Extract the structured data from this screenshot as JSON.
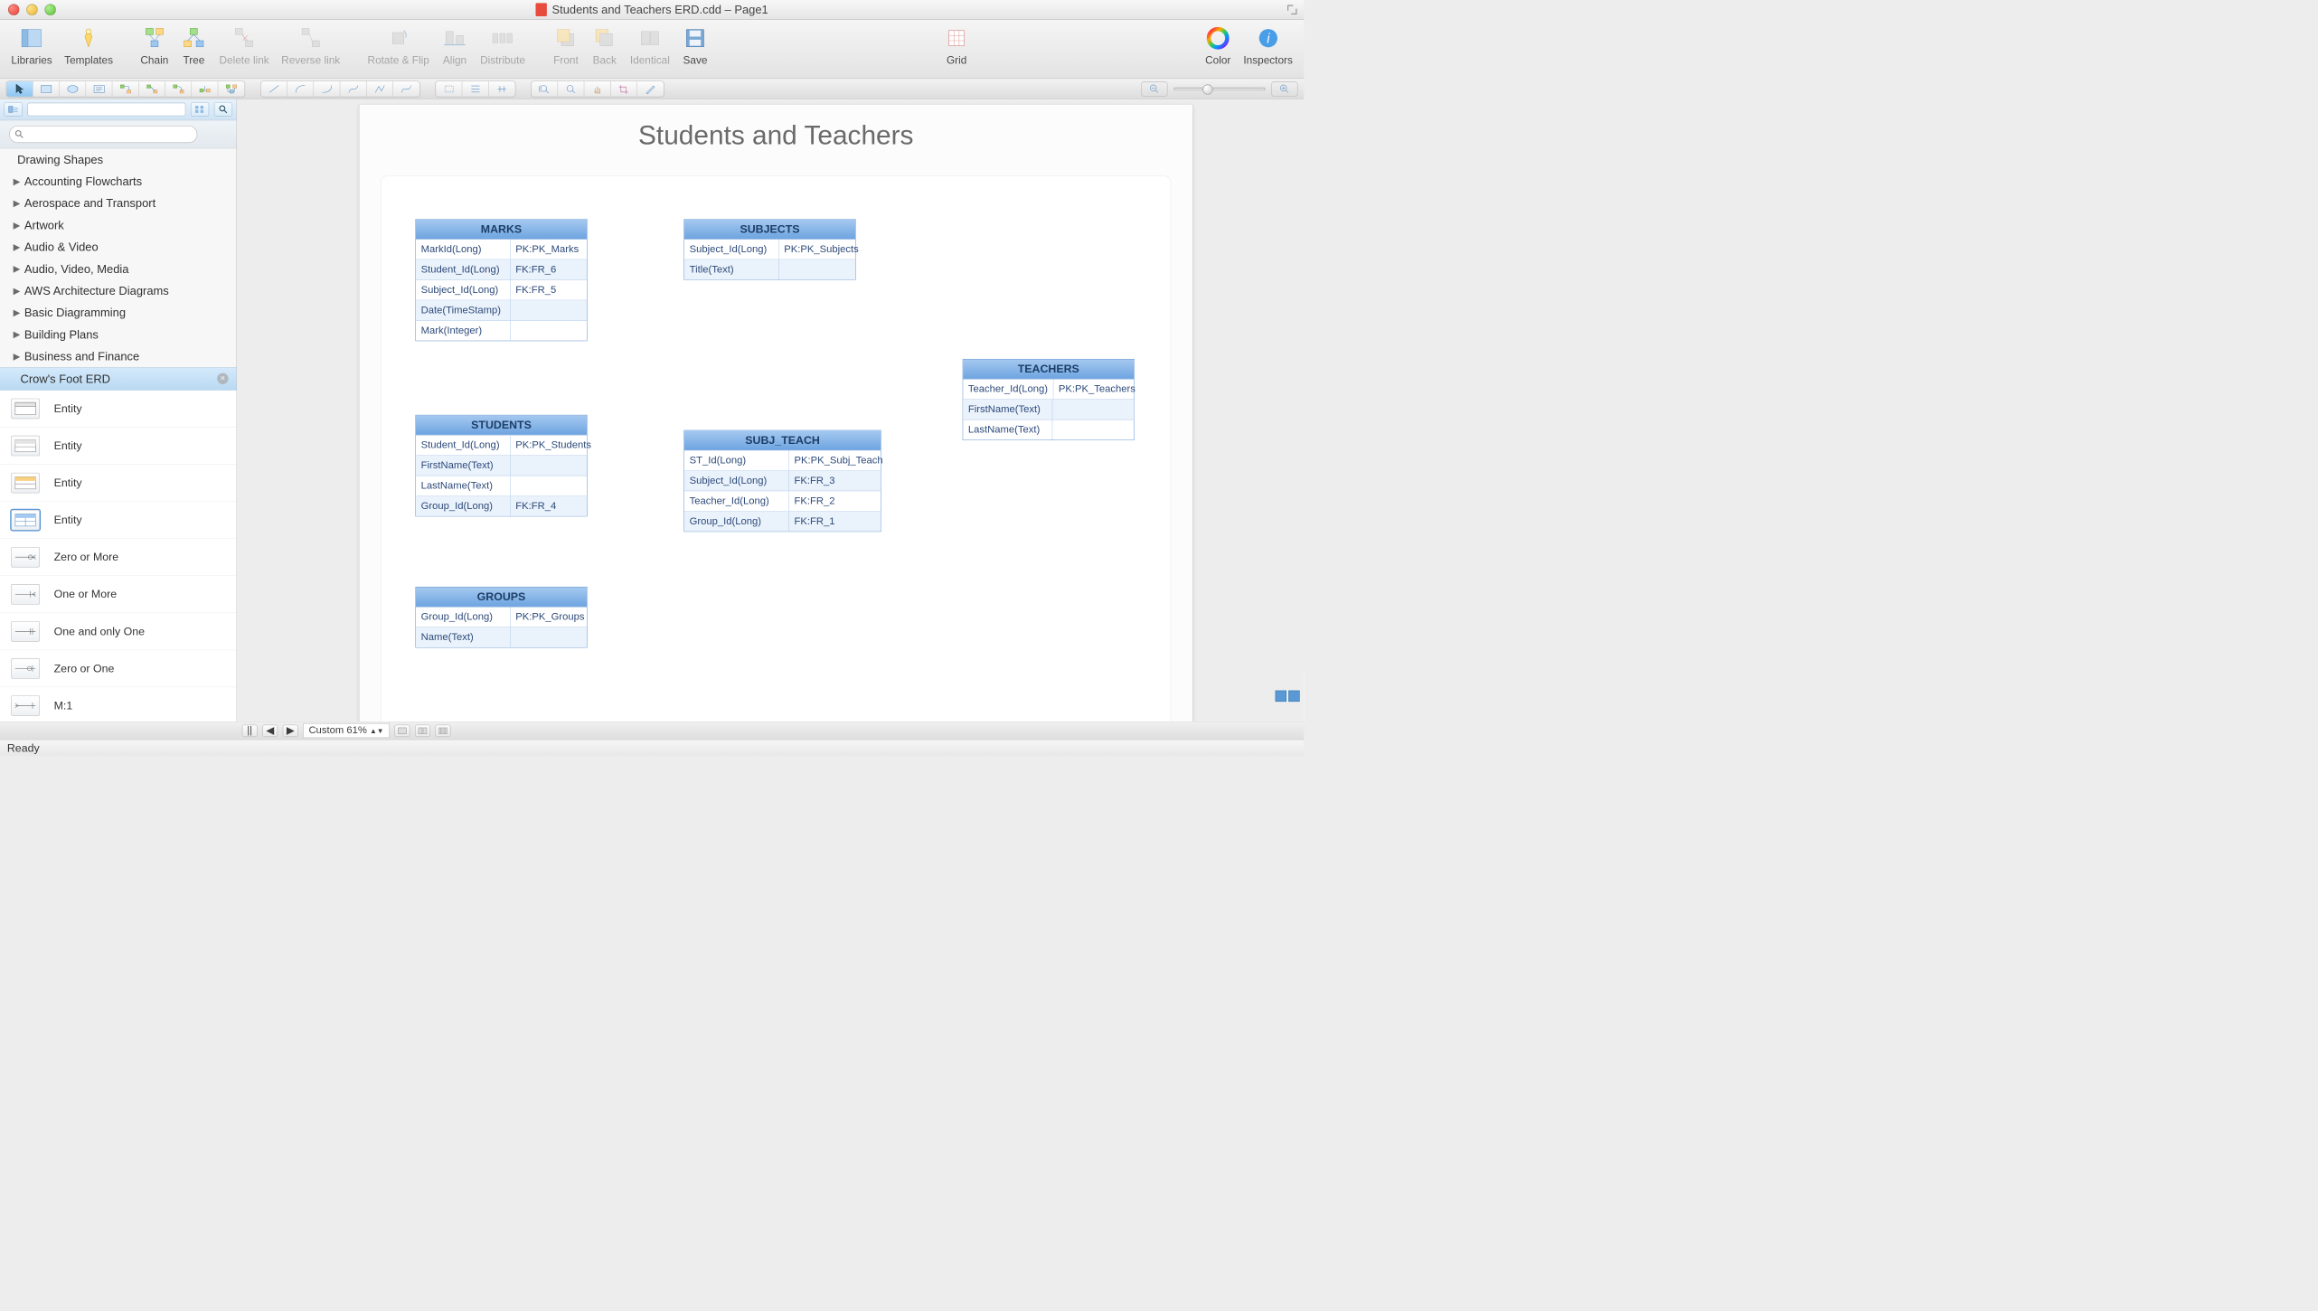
{
  "window": {
    "title": "Students and Teachers ERD.cdd – Page1"
  },
  "toolbar": {
    "libraries": "Libraries",
    "templates": "Templates",
    "chain": "Chain",
    "tree": "Tree",
    "delete_link": "Delete link",
    "reverse_link": "Reverse link",
    "rotate_flip": "Rotate & Flip",
    "align": "Align",
    "distribute": "Distribute",
    "front": "Front",
    "back": "Back",
    "identical": "Identical",
    "save": "Save",
    "grid": "Grid",
    "color": "Color",
    "inspectors": "Inspectors"
  },
  "sidebar": {
    "drawing_shapes": "Drawing Shapes",
    "categories": [
      "Accounting Flowcharts",
      "Aerospace and Transport",
      "Artwork",
      "Audio & Video",
      "Audio, Video, Media",
      "AWS Architecture Diagrams",
      "Basic Diagramming",
      "Building Plans",
      "Business and Finance"
    ],
    "active_category": "Crow's Foot ERD",
    "shapes": [
      {
        "label": "Entity"
      },
      {
        "label": "Entity"
      },
      {
        "label": "Entity"
      },
      {
        "label": "Entity"
      },
      {
        "label": "Zero or More"
      },
      {
        "label": "One or More"
      },
      {
        "label": "One and only One"
      },
      {
        "label": "Zero or One"
      },
      {
        "label": "M:1"
      }
    ]
  },
  "diagram": {
    "title": "Students and Teachers",
    "entities": {
      "marks": {
        "name": "MARKS",
        "rows": [
          {
            "c1": "MarkId(Long)",
            "c2": "PK:PK_Marks"
          },
          {
            "c1": "Student_Id(Long)",
            "c2": "FK:FR_6"
          },
          {
            "c1": "Subject_Id(Long)",
            "c2": "FK:FR_5"
          },
          {
            "c1": "Date(TimeStamp)",
            "c2": ""
          },
          {
            "c1": "Mark(Integer)",
            "c2": ""
          }
        ]
      },
      "subjects": {
        "name": "SUBJECTS",
        "rows": [
          {
            "c1": "Subject_Id(Long)",
            "c2": "PK:PK_Subjects"
          },
          {
            "c1": "Title(Text)",
            "c2": ""
          }
        ]
      },
      "students": {
        "name": "STUDENTS",
        "rows": [
          {
            "c1": "Student_Id(Long)",
            "c2": "PK:PK_Students"
          },
          {
            "c1": "FirstName(Text)",
            "c2": ""
          },
          {
            "c1": "LastName(Text)",
            "c2": ""
          },
          {
            "c1": "Group_Id(Long)",
            "c2": "FK:FR_4"
          }
        ]
      },
      "subj_teach": {
        "name": "SUBJ_TEACH",
        "rows": [
          {
            "c1": "ST_Id(Long)",
            "c2": "PK:PK_Subj_Teach"
          },
          {
            "c1": "Subject_Id(Long)",
            "c2": "FK:FR_3"
          },
          {
            "c1": "Teacher_Id(Long)",
            "c2": "FK:FR_2"
          },
          {
            "c1": "Group_Id(Long)",
            "c2": "FK:FR_1"
          }
        ]
      },
      "teachers": {
        "name": "TEACHERS",
        "rows": [
          {
            "c1": "Teacher_Id(Long)",
            "c2": "PK:PK_Teachers"
          },
          {
            "c1": "FirstName(Text)",
            "c2": ""
          },
          {
            "c1": "LastName(Text)",
            "c2": ""
          }
        ]
      },
      "groups": {
        "name": "GROUPS",
        "rows": [
          {
            "c1": "Group_Id(Long)",
            "c2": "PK:PK_Groups"
          },
          {
            "c1": "Name(Text)",
            "c2": ""
          }
        ]
      }
    }
  },
  "footer": {
    "zoom_label": "Custom 61%",
    "status": "Ready"
  }
}
